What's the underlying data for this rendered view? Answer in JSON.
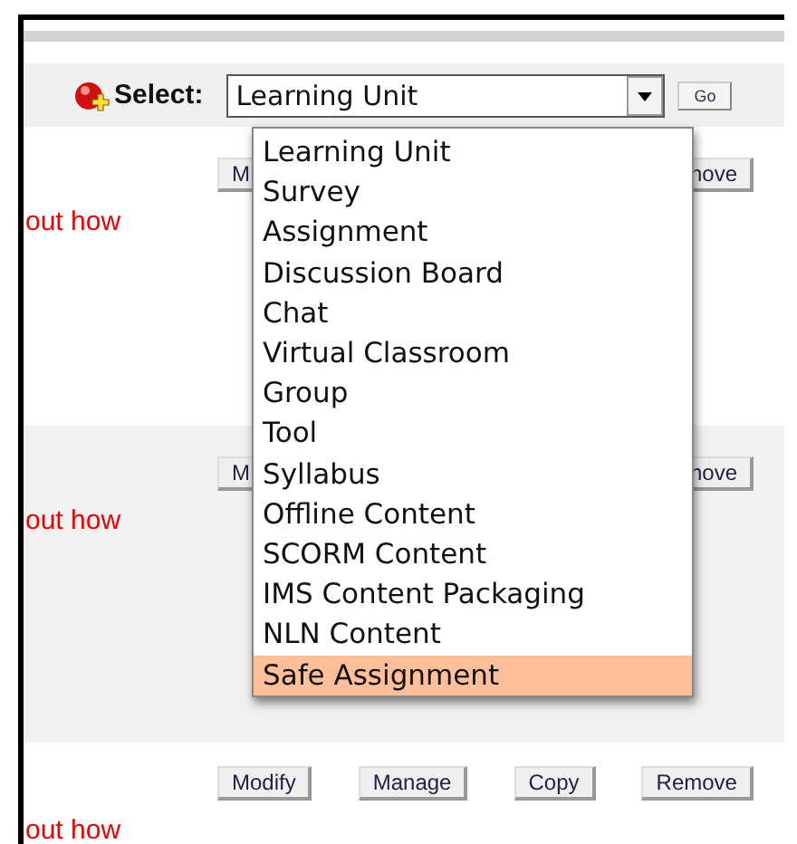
{
  "select_bar": {
    "label": "Select:",
    "value": "Learning Unit",
    "go_button": "Go"
  },
  "dropdown": {
    "options": [
      {
        "label": "Learning Unit",
        "selected": false
      },
      {
        "label": "Survey",
        "selected": false
      },
      {
        "label": "Assignment",
        "selected": false
      },
      {
        "label": "Discussion Board",
        "selected": false
      },
      {
        "label": "Chat",
        "selected": false
      },
      {
        "label": "Virtual Classroom",
        "selected": false
      },
      {
        "label": "Group",
        "selected": false
      },
      {
        "label": "Tool",
        "selected": false
      },
      {
        "label": "Syllabus",
        "selected": false
      },
      {
        "label": "Offline Content",
        "selected": false
      },
      {
        "label": "SCORM Content",
        "selected": false
      },
      {
        "label": "IMS Content Packaging",
        "selected": false
      },
      {
        "label": "NLN Content",
        "selected": false
      },
      {
        "label": "Safe Assignment",
        "selected": true
      }
    ]
  },
  "rows": [
    {
      "buttons": [
        "M",
        "nove"
      ],
      "text": "out how"
    },
    {
      "buttons": [
        "M",
        "nove"
      ],
      "text": "out how"
    },
    {
      "buttons": [
        "Modify",
        "Manage",
        "Copy",
        "Remove"
      ],
      "text": "out how"
    }
  ]
}
